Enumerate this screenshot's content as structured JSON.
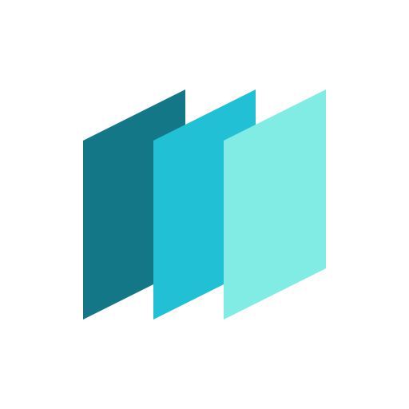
{
  "logo": {
    "icon": "stacked-panels-logo-icon",
    "panels": [
      {
        "name": "back-panel",
        "color": "#147787"
      },
      {
        "name": "middle-panel",
        "color": "#21C0D5"
      },
      {
        "name": "front-panel",
        "color": "#80ECE3"
      }
    ],
    "background_color": "#FFFFFF"
  }
}
